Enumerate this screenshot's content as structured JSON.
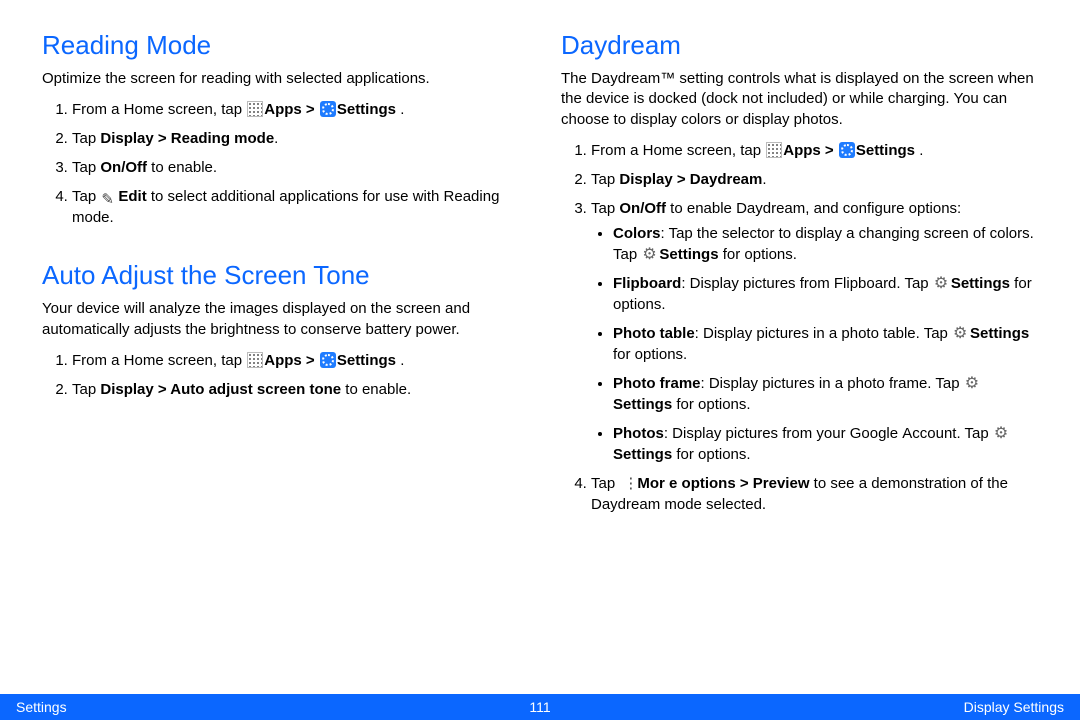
{
  "left": {
    "reading": {
      "heading": "Reading Mode",
      "intro": "Optimize the screen for reading with selected applications.",
      "step1_a": "From a Home screen, tap ",
      "step1_b": "Apps > ",
      "step1_c": "Settings",
      "step1_d": " .",
      "step2_a": "Tap ",
      "step2_b": "Display > Reading mode",
      "step2_c": ".",
      "step3_a": "Tap ",
      "step3_b": "On/Off",
      "step3_c": " to enable.",
      "step4_a": "Tap ",
      "step4_b": "Edit",
      "step4_c": " to select additional applications for use with Reading mode."
    },
    "auto": {
      "heading": "Auto Adjust the Screen Tone",
      "intro": "Your device will analyze the images displayed on the screen and automatically adjusts the brightness to conserve battery power.",
      "step1_a": "From a Home screen, tap ",
      "step1_b": "Apps > ",
      "step1_c": "Settings",
      "step1_d": " .",
      "step2_a": "Tap ",
      "step2_b": "Display > Auto adjust screen tone",
      "step2_c": " to enable."
    }
  },
  "right": {
    "day": {
      "heading": "Daydream",
      "intro": "The Daydream™ setting controls what is displayed on the screen when the device is docked (dock not included) or while charging. You can choose to display colors or display photos.",
      "step1_a": "From a Home screen, tap ",
      "step1_b": "Apps > ",
      "step1_c": "Settings",
      "step1_d": " .",
      "step2_a": "Tap ",
      "step2_b": "Display > Daydream",
      "step2_c": ".",
      "step3_a": "Tap ",
      "step3_b": "On/Off",
      "step3_c": " to enable Daydream, and configure options:",
      "b_colors_a": "Colors",
      "b_colors_b": ": Tap the selector to display a changing screen of colors. Tap ",
      "b_colors_c": "Settings",
      "b_colors_d": " for options.",
      "b_flip_a": "Flipboard",
      "b_flip_b": ": Display pictures from Flipboard. Tap ",
      "b_flip_c": "Settings",
      "b_flip_d": " for options.",
      "b_table_a": "Photo table",
      "b_table_b": ": Display pictures in a photo table. Tap ",
      "b_table_c": "Settings",
      "b_table_d": "  for options.",
      "b_frame_a": "Photo frame",
      "b_frame_b": ": Display pictures in a photo frame. Tap ",
      "b_frame_c": "Settings",
      "b_frame_d": "  for options.",
      "b_photos_a": "Photos",
      "b_photos_b": ": Display pictures from your Google Account. Tap ",
      "b_photos_c": "Settings",
      "b_photos_d": " for options.",
      "step4_a": "Tap ",
      "step4_b": "Mor e options > Preview",
      "step4_c": " to see a demonstration of the Daydream mode selected."
    }
  },
  "footer": {
    "left": "Settings",
    "mid": "111",
    "right": "Display Settings"
  }
}
